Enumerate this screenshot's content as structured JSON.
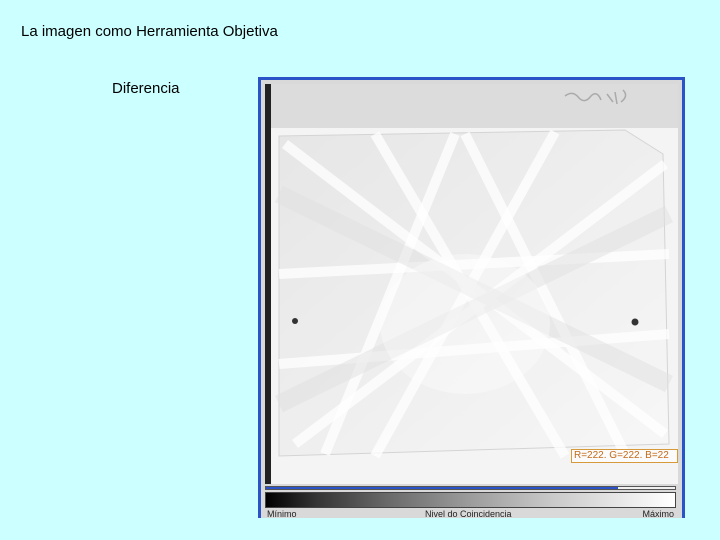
{
  "slide": {
    "title": "La imagen como Herramienta Objetiva",
    "subtitle": "Diferencia"
  },
  "viewer": {
    "pixel_readout": "R=222. G=222. B=22",
    "scale": {
      "min_label": "Mínimo",
      "mid_label": "Nivel do Coincidencia",
      "max_label": "Máximo",
      "level_fraction": 0.86
    }
  },
  "colors": {
    "background": "#ccffff",
    "frame": "#2a53c8",
    "readout": "#c46a18"
  }
}
